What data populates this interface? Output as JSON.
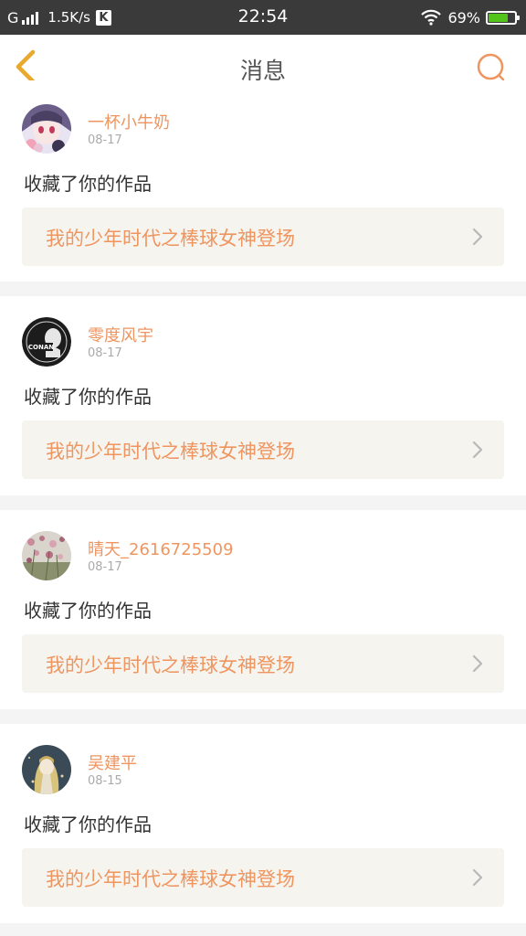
{
  "status_bar": {
    "network": "G",
    "speed": "1.5K/s",
    "app_badge": "K",
    "time": "22:54",
    "battery": "69%",
    "battery_level": 0.69,
    "battery_color": "#52c41a"
  },
  "header": {
    "title": "消息",
    "back_icon": "chevron-left-icon",
    "search_icon": "search-icon"
  },
  "colors": {
    "accent": "#ef9560",
    "back_arrow": "#e8a92c",
    "card_box": "#f5f4ee"
  },
  "messages": [
    {
      "username": "一杯小牛奶",
      "date": "08-17",
      "action": "收藏了你的作品",
      "work_title": "我的少年时代之棒球女神登场",
      "avatar_icon": "anime-girl-avatar"
    },
    {
      "username": "零度风宇",
      "date": "08-17",
      "action": "收藏了你的作品",
      "work_title": "我的少年时代之棒球女神登场",
      "avatar_icon": "detective-conan-avatar",
      "avatar_text": "CONAN"
    },
    {
      "username": "晴天_2616725509",
      "date": "08-17",
      "action": "收藏了你的作品",
      "work_title": "我的少年时代之棒球女神登场",
      "avatar_icon": "flower-photo-avatar"
    },
    {
      "username": "吴建平",
      "date": "08-15",
      "action": "收藏了你的作品",
      "work_title": "我的少年时代之棒球女神登场",
      "avatar_icon": "illustrated-girl-avatar"
    }
  ]
}
